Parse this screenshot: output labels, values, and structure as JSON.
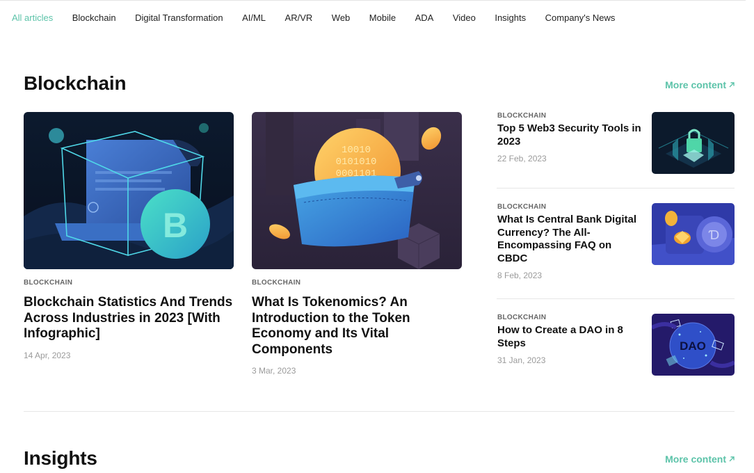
{
  "nav": {
    "items": [
      {
        "label": "All articles",
        "active": true
      },
      {
        "label": "Blockchain"
      },
      {
        "label": "Digital Transformation"
      },
      {
        "label": "AI/ML"
      },
      {
        "label": "AR/VR"
      },
      {
        "label": "Web"
      },
      {
        "label": "Mobile"
      },
      {
        "label": "ADA"
      },
      {
        "label": "Video"
      },
      {
        "label": "Insights"
      },
      {
        "label": "Company's News"
      }
    ]
  },
  "sections": {
    "blockchain": {
      "title": "Blockchain",
      "more_label": "More content",
      "featured": [
        {
          "tag": "BLOCKCHAIN",
          "title": "Blockchain Statistics And Trends Across Industries in 2023 [With Infographic]",
          "date": "14 Apr, 2023",
          "thumb": "bitcoin-document-cube-illustration"
        },
        {
          "tag": "BLOCKCHAIN",
          "title": "What Is Tokenomics? An Introduction to the Token Economy and Its Vital Components",
          "date": "3 Mar, 2023",
          "thumb": "wallet-coins-illustration"
        }
      ],
      "list": [
        {
          "tag": "BLOCKCHAIN",
          "title": "Top 5 Web3 Security Tools in 2023",
          "date": "22 Feb, 2023",
          "thumb": "padlock-hologram-illustration"
        },
        {
          "tag": "BLOCKCHAIN",
          "title": "What Is Central Bank Digital Currency? The All-Encompassing FAQ on CBDC",
          "date": "8 Feb, 2023",
          "thumb": "vault-coins-illustration"
        },
        {
          "tag": "BLOCKCHAIN",
          "title": "How to Create a DAO in 8 Steps",
          "date": "31 Jan, 2023",
          "thumb": "dao-globe-illustration"
        }
      ]
    },
    "insights": {
      "title": "Insights",
      "more_label": "More content"
    }
  },
  "colors": {
    "accent": "#5cc3a9",
    "text": "#111111",
    "muted": "#9a9a9a",
    "rule": "#e6e6e6"
  }
}
